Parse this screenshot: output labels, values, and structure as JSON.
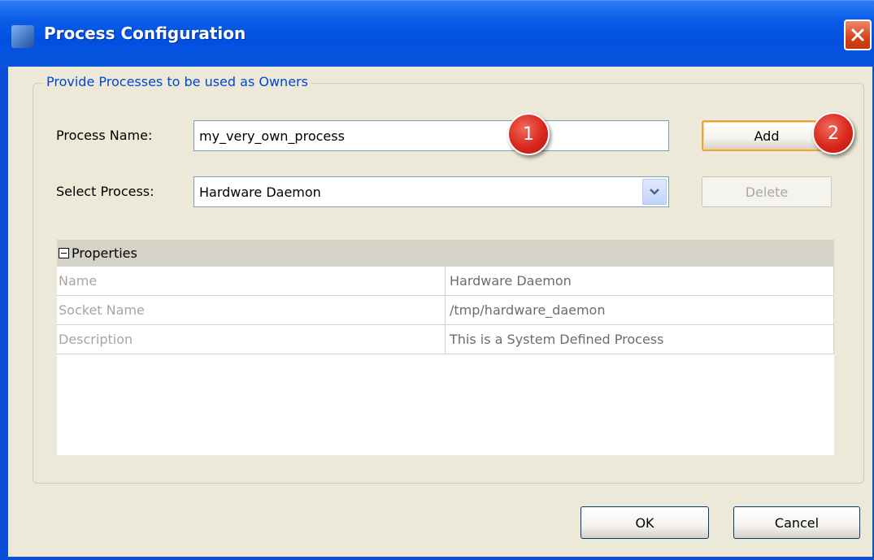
{
  "window": {
    "title": "Process Configuration",
    "colors": {
      "titlebar": "#0a5ce8",
      "close": "#d4431c",
      "client": "#ece9d8"
    }
  },
  "group": {
    "legend": "Provide Processes to be used as Owners",
    "process_name": {
      "label": "Process Name:",
      "value": "my_very_own_process"
    },
    "select_process": {
      "label": "Select Process:",
      "value": "Hardware Daemon"
    },
    "add_label": "Add",
    "delete_label": "Delete"
  },
  "annotations": [
    "1",
    "2"
  ],
  "properties": {
    "header": "Properties",
    "rows": [
      {
        "name": "Name",
        "value": "Hardware Daemon"
      },
      {
        "name": "Socket Name",
        "value": "/tmp/hardware_daemon"
      },
      {
        "name": "Description",
        "value": "This is a System Defined Process"
      }
    ]
  },
  "footer": {
    "ok_label": "OK",
    "cancel_label": "Cancel"
  }
}
